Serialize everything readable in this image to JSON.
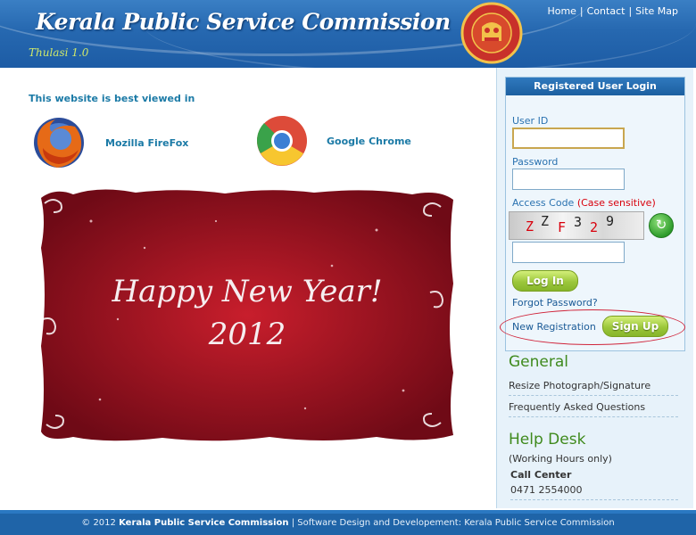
{
  "header": {
    "title": "Kerala Public Service Commission",
    "sub_logo": "Thulasi 1.0",
    "links": [
      "Home",
      "Contact",
      "Site Map"
    ],
    "emblem_label": "PUBLIC SERVICE COMMISSION KERALA"
  },
  "browsers": {
    "heading": "This website is best viewed in",
    "items": [
      {
        "label": "Mozilla FireFox",
        "icon": "firefox-icon"
      },
      {
        "label": "Google Chrome",
        "icon": "chrome-icon"
      }
    ]
  },
  "greeting_card": {
    "line1": "Happy New Year!",
    "line2": "2012",
    "bg_color": "#8e0f1c"
  },
  "login": {
    "heading": "Registered User Login",
    "userid_label": "User ID",
    "userid_value": "",
    "password_label": "Password",
    "access_code_label": "Access Code",
    "case_sensitive": "(Case sensitive)",
    "captcha": [
      "Z",
      "Z",
      "F",
      "3",
      "2",
      "9"
    ],
    "login_button": "Log In",
    "forgot_password": "Forgot Password?",
    "new_registration": "New Registration",
    "signup_button": "Sign Up"
  },
  "general": {
    "heading": "General",
    "links": [
      "Resize Photograph/Signature",
      "Frequently Asked Questions"
    ]
  },
  "helpdesk": {
    "heading": "Help Desk",
    "hours": "(Working Hours only)",
    "call_center_label": "Call Center",
    "phone": "0471 2554000"
  },
  "footer": {
    "copyright": "© 2012",
    "org": "Kerala Public Service Commission",
    "separator": "|",
    "credit": "Software Design and Developement: Kerala Public Service Commission"
  },
  "colors": {
    "header_blue": "#2668b0",
    "link_blue": "#1b7aa6",
    "green_button": "#9cc73b",
    "highlight_red": "#d0243a"
  }
}
